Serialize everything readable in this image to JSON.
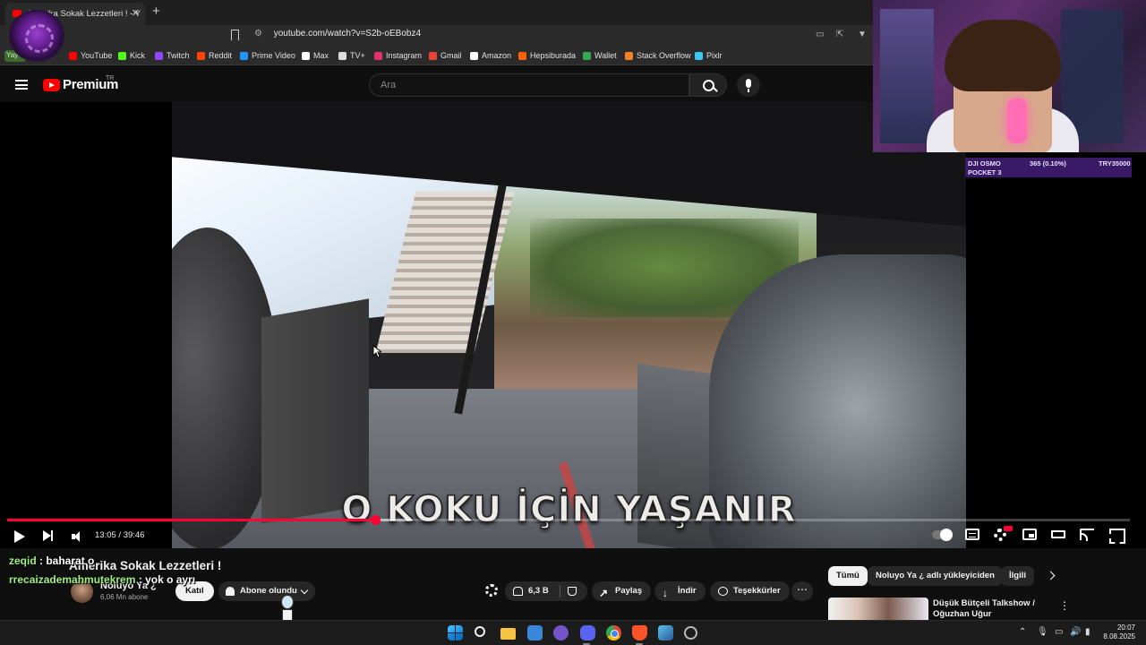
{
  "browser": {
    "tab_title": "Amerika Sokak Lezzetleri ! - Y",
    "new_tab": "+",
    "url": "youtube.com/watch?v=S2b-oEBobz4",
    "bookmark_badge": "Yay",
    "bookmarks": [
      {
        "label": "YouTube",
        "color": "#ff0000"
      },
      {
        "label": "Kick",
        "color": "#53fc18"
      },
      {
        "label": "Twitch",
        "color": "#9146ff"
      },
      {
        "label": "Reddit",
        "color": "#ff4500"
      },
      {
        "label": "Prime Video",
        "color": "#1a98ff"
      },
      {
        "label": "Max",
        "color": "#ffffff"
      },
      {
        "label": "TV+",
        "color": "#dddddd"
      },
      {
        "label": "Instagram",
        "color": "#e1306c"
      },
      {
        "label": "Gmail",
        "color": "#ea4335"
      },
      {
        "label": "Amazon",
        "color": "#ffffff"
      },
      {
        "label": "Hepsiburada",
        "color": "#ff6000"
      },
      {
        "label": "Wallet",
        "color": "#34a853"
      },
      {
        "label": "Stack Overflow",
        "color": "#f48024"
      },
      {
        "label": "Pixlr",
        "color": "#3ec7f2"
      }
    ]
  },
  "overlay": {
    "promo_product": "DJI OSMO",
    "promo_product2": "POCKET 3",
    "promo_price": "365 (0.10%)",
    "promo_code": "TRY35000"
  },
  "youtube": {
    "logo_text": "Premium",
    "region": "TR",
    "search_placeholder": "Ara"
  },
  "player": {
    "caption": "O KOKU İÇİN YAŞANIR",
    "time": "13:05 / 39:46",
    "progress_played": 0.328,
    "progress_loaded": 0.36
  },
  "video": {
    "title": "Amerika Sokak Lezzetleri !",
    "channel": "Noluyo Ya ¿",
    "subscribers": "6,06 Mn abone",
    "join_label": "Katıl",
    "subscribed_label": "Abone olundu",
    "likes": "6,3 B",
    "share_label": "Paylaş",
    "download_label": "İndir",
    "thanks_label": "Teşekkürler",
    "more_label": "⋯"
  },
  "chips": [
    {
      "label": "Tümü",
      "active": true
    },
    {
      "label": "Noluyo Ya ¿ adlı yükleyiciden",
      "active": false
    },
    {
      "label": "İlgili",
      "active": false
    }
  ],
  "recommendation": {
    "title": "Düşük Bütçeli Talkshow / Oğuzhan Uğur @babalavkativi",
    "menu": "⋮"
  },
  "chat": [
    {
      "user": "zeqid",
      "message": " : baharat o"
    },
    {
      "user": "rrecaizademahmutekrem",
      "message": " : yok o ayrı"
    }
  ],
  "taskbar": {
    "time": "20:07",
    "date": "8.08.2025"
  }
}
